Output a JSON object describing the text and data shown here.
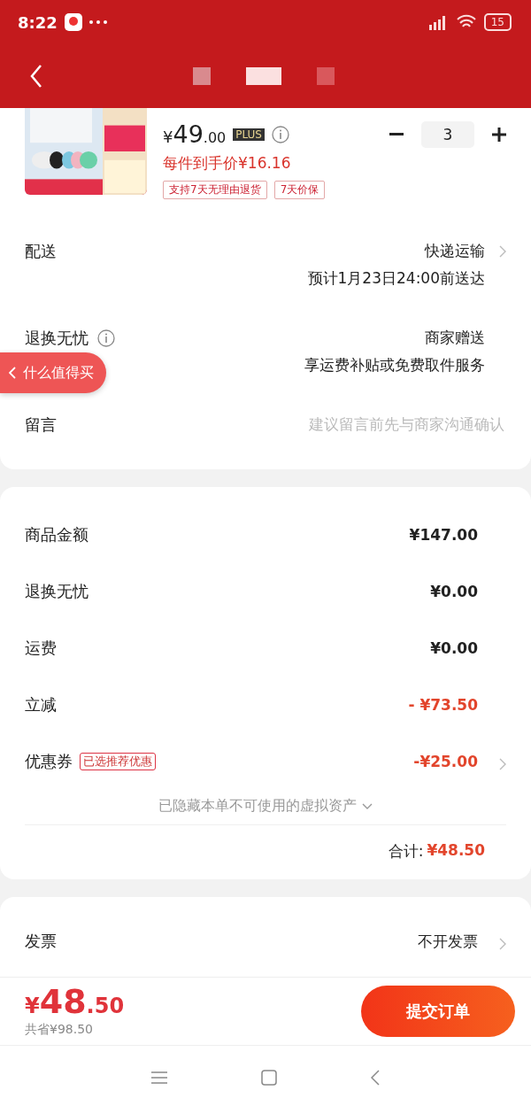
{
  "status_bar": {
    "time": "8:22",
    "battery": "15"
  },
  "product": {
    "currency": "¥",
    "price_integer": "49",
    "price_decimal": ".00",
    "member_badge": "PLUS",
    "unit_price": "每件到手价¥16.16",
    "tags": [
      "支持7天无理由退货",
      "7天价保"
    ],
    "quantity": "3"
  },
  "order_rows": [
    {
      "kind": "info",
      "label": "配送",
      "info_icon": false,
      "lines": [
        "快递运输",
        "预计1月23日24:00前送达"
      ],
      "chevron": true
    },
    {
      "kind": "info",
      "label": "退换无忧",
      "info_icon": true,
      "lines": [
        "商家赠送",
        "享运费补贴或免费取件服务"
      ],
      "chevron": false
    },
    {
      "kind": "input",
      "label": "留言",
      "placeholder": "建议留言前先与商家沟通确认"
    }
  ],
  "floating_link": "什么值得买",
  "summary_rows": [
    {
      "label": "商品金额",
      "value": "¥147.00",
      "discount": false,
      "chevron": false
    },
    {
      "label": "退换无忧",
      "value": "¥0.00",
      "discount": false,
      "chevron": false
    },
    {
      "label": "运费",
      "value": "¥0.00",
      "discount": false,
      "chevron": false
    },
    {
      "label": "立减",
      "value": "- ¥73.50",
      "discount": true,
      "chevron": false
    },
    {
      "label": "优惠券",
      "badge": "已选推荐优惠",
      "value": "-¥25.00",
      "discount": true,
      "chevron": true
    }
  ],
  "hidden_assets_note": "已隐藏本单不可使用的虚拟资产",
  "total": {
    "label": "合计:",
    "value": "¥48.50"
  },
  "invoice": {
    "label": "发票",
    "value": "不开发票"
  },
  "footer": {
    "currency": "¥",
    "price_integer": "48",
    "price_decimal": ".50",
    "savings": "共省¥98.50",
    "submit": "提交订单"
  }
}
